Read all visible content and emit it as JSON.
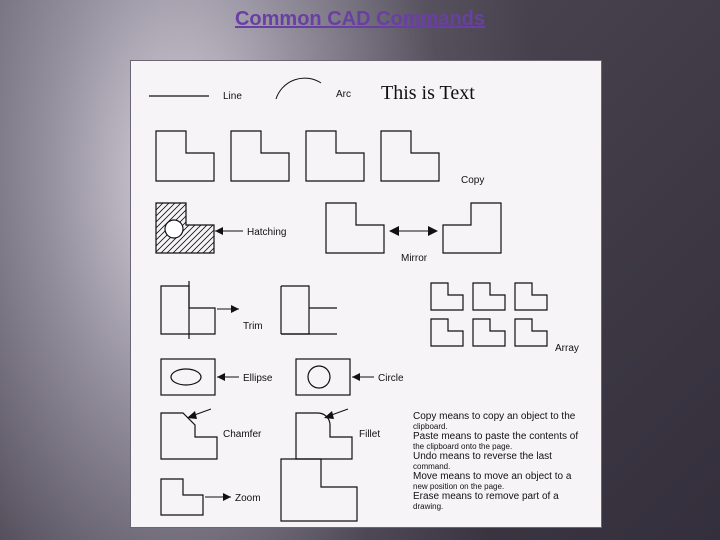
{
  "title": "Common CAD Commands",
  "labels": {
    "line": "Line",
    "arc": "Arc",
    "text_sample": "This is Text",
    "copy": "Copy",
    "hatching": "Hatching",
    "mirror": "Mirror",
    "trim": "Trim",
    "ellipse": "Ellipse",
    "circle": "Circle",
    "array": "Array",
    "chamfer": "Chamfer",
    "fillet": "Fillet",
    "zoom": "Zoom"
  },
  "desc": {
    "copy_b": "Copy",
    "copy_t": " means to copy an object to the",
    "copy_t2": "clipboard.",
    "paste_b": "Paste",
    "paste_t": " means to paste the contents of",
    "paste_t2": "the clipboard onto the page.",
    "undo_b": "Undo",
    "undo_t": " means to reverse the last",
    "undo_t2": "command.",
    "move_b": "Move",
    "move_t": " means to move an object to a",
    "move_t2": "new position on the page.",
    "erase_b": "Erase",
    "erase_t": " means to remove part of a",
    "erase_t2": "drawing."
  }
}
